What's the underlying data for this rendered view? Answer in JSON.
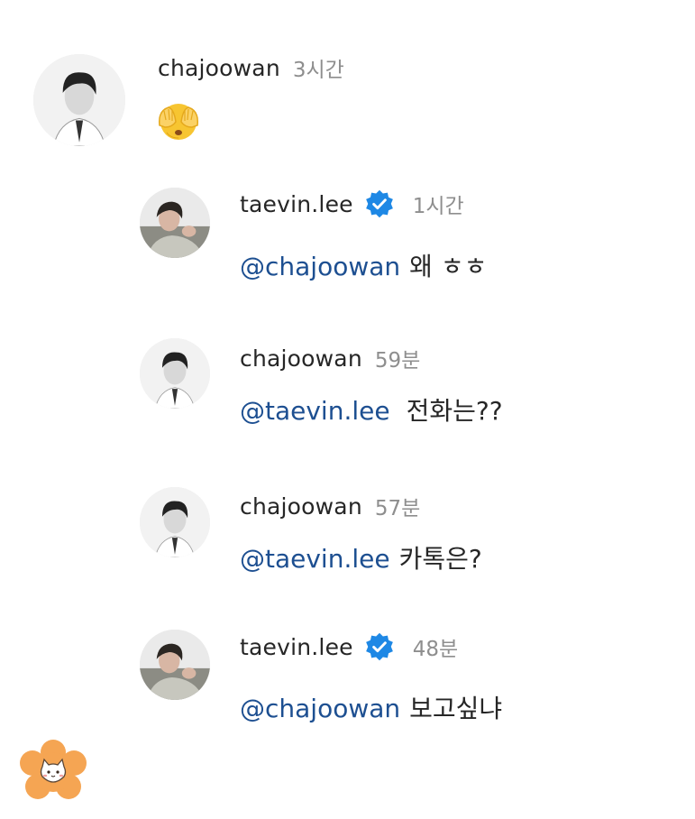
{
  "comments": [
    {
      "username": "chajoowan",
      "time": "3시간",
      "verified": false,
      "mention": "",
      "text": "",
      "emoji": "face-hiding-eyes"
    },
    {
      "username": "taevin.lee",
      "time": "1시간",
      "verified": true,
      "mention": "@chajoowan",
      "text": "왜 ㅎㅎ"
    },
    {
      "username": "chajoowan",
      "time": "59분",
      "verified": false,
      "mention": "@taevin.lee",
      "text": "전화는??"
    },
    {
      "username": "chajoowan",
      "time": "57분",
      "verified": false,
      "mention": "@taevin.lee",
      "text": "카톡은?"
    },
    {
      "username": "taevin.lee",
      "time": "48분",
      "verified": true,
      "mention": "@chajoowan",
      "text": "보고싶냐"
    }
  ],
  "colors": {
    "mention": "#1d4f91",
    "verified": "#1e88e5",
    "time": "#8e8e8e",
    "sticker": "#f5a553"
  },
  "icons": {
    "verified": "verified-badge-icon",
    "sticker": "cat-flower-sticker"
  }
}
